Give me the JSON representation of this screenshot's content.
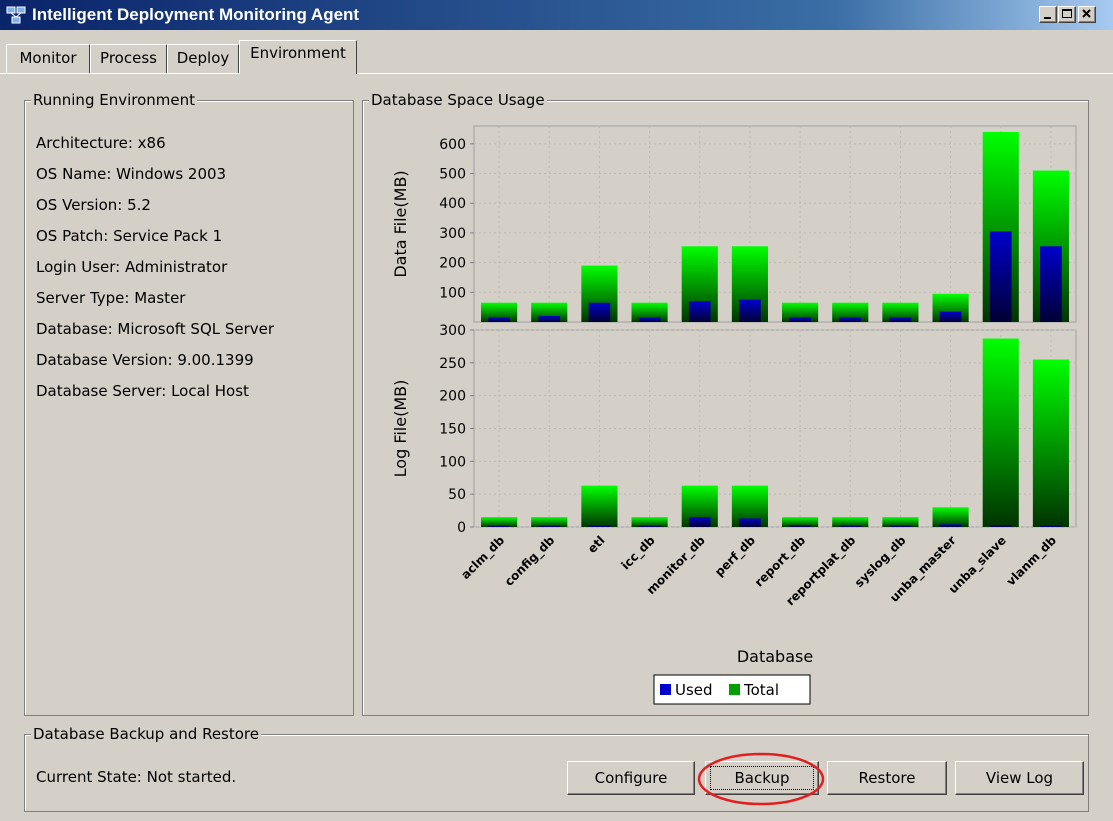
{
  "window": {
    "title": "Intelligent Deployment Monitoring Agent",
    "icon": "network-agent-icon",
    "controls": [
      "minimize",
      "maximize",
      "close"
    ]
  },
  "tabs": [
    {
      "label": "Monitor",
      "active": false
    },
    {
      "label": "Process",
      "active": false
    },
    {
      "label": "Deploy",
      "active": false
    },
    {
      "label": "Environment",
      "active": true
    }
  ],
  "running_environment": {
    "title": "Running Environment",
    "lines": [
      "Architecture: x86",
      "OS Name: Windows 2003",
      "OS Version: 5.2",
      "OS Patch: Service Pack 1",
      "Login User: Administrator",
      "Server Type: Master",
      "Database: Microsoft SQL Server",
      "Database Version: 9.00.1399",
      "Database Server: Local Host"
    ]
  },
  "space_usage": {
    "title": "Database Space Usage"
  },
  "chart_data": {
    "type": "bar",
    "categories": [
      "aclm_db",
      "config_db",
      "etl",
      "icc_db",
      "monitor_db",
      "perf_db",
      "report_db",
      "reportplat_db",
      "syslog_db",
      "unba_master",
      "unba_slave",
      "vlanm_db"
    ],
    "xlabel": "Database",
    "legend": [
      "Used",
      "Total"
    ],
    "legend_position": "bottom-center",
    "colors": {
      "used": "#0000cc",
      "total": "#00ff00"
    },
    "grid": true,
    "subplots": [
      {
        "ylabel": "Data File(MB)",
        "ylim": [
          0,
          660
        ],
        "yticks": [
          100,
          200,
          300,
          400,
          500,
          600
        ],
        "series": [
          {
            "name": "Used",
            "values": [
              15,
              20,
              65,
              15,
              70,
              75,
              15,
              15,
              15,
              35,
              305,
              255
            ]
          },
          {
            "name": "Total",
            "values": [
              65,
              65,
              190,
              65,
              255,
              255,
              65,
              65,
              65,
              95,
              640,
              510
            ]
          }
        ]
      },
      {
        "ylabel": "Log File(MB)",
        "ylim": [
          0,
          300
        ],
        "yticks": [
          0,
          50,
          100,
          150,
          200,
          250,
          300
        ],
        "series": [
          {
            "name": "Used",
            "values": [
              2,
              2,
              2,
              2,
              15,
              13,
              3,
              2,
              2,
              4,
              3,
              2
            ]
          },
          {
            "name": "Total",
            "values": [
              15,
              15,
              63,
              15,
              63,
              63,
              15,
              15,
              15,
              30,
              287,
              255
            ]
          }
        ]
      }
    ]
  },
  "backup_restore": {
    "title": "Database Backup and Restore",
    "state": "Current State: Not started.",
    "buttons": {
      "configure": "Configure",
      "backup": "Backup",
      "restore": "Restore",
      "view_log": "View Log"
    },
    "highlight_color": "#e02020"
  }
}
